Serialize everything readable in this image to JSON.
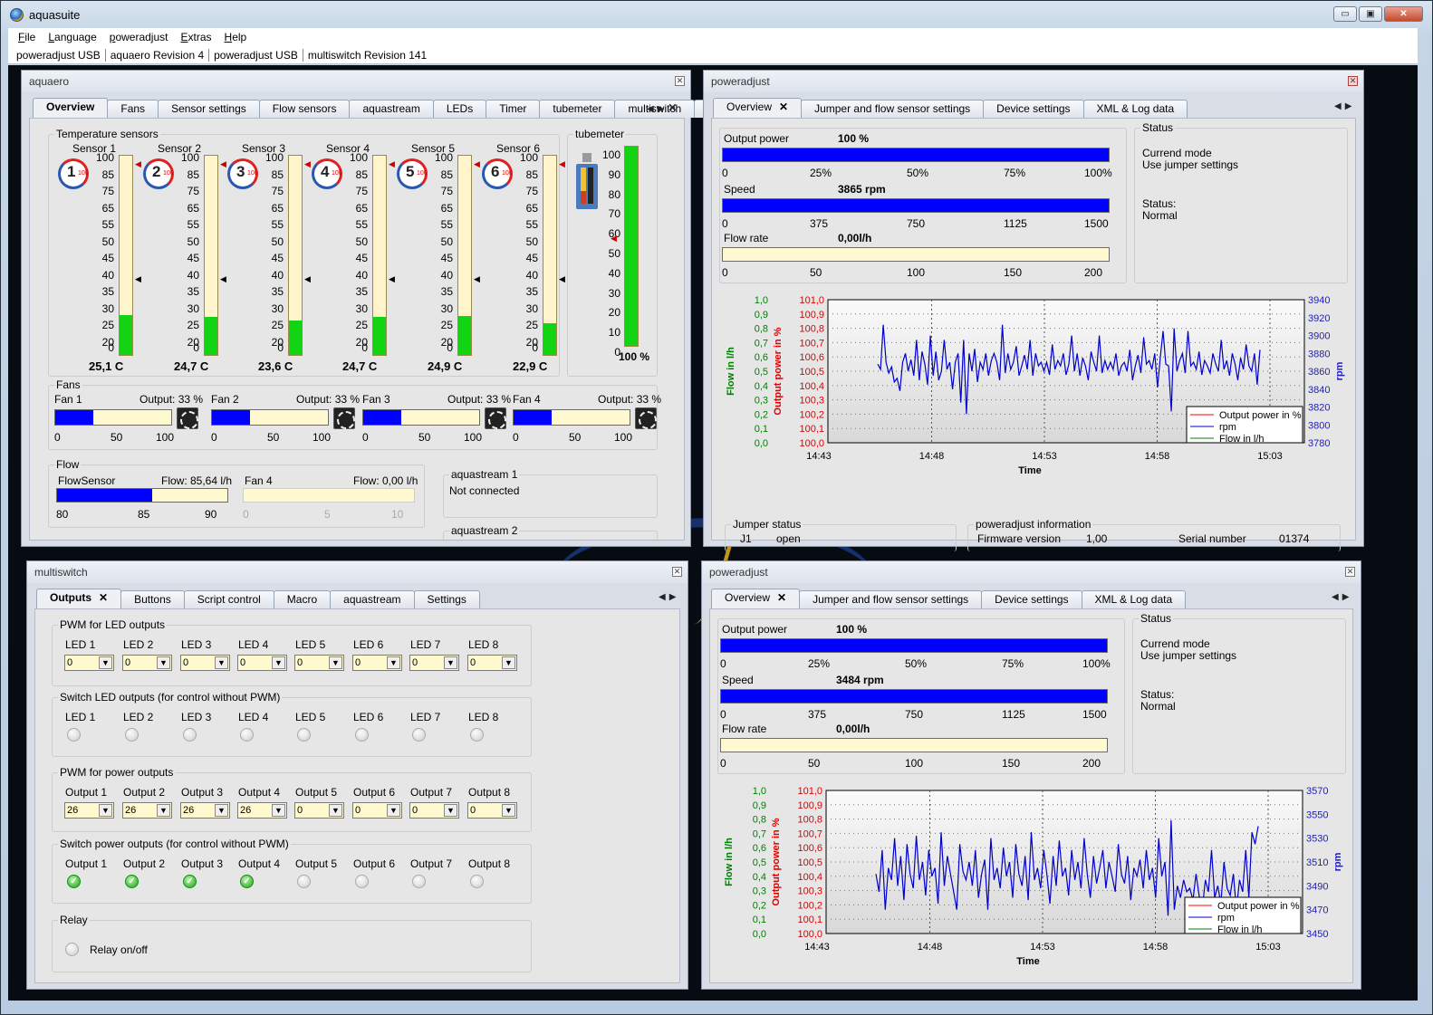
{
  "app": {
    "title": "aquasuite"
  },
  "window_buttons": {
    "minimize": "▭",
    "maximize": "▣",
    "close": "✕"
  },
  "menu": [
    {
      "u": "F",
      "rest": "ile"
    },
    {
      "u": "L",
      "rest": "anguage"
    },
    {
      "u": "p",
      "rest": "oweradjust"
    },
    {
      "u": "E",
      "rest": "xtras"
    },
    {
      "u": "H",
      "rest": "elp"
    }
  ],
  "statusbar": [
    "poweradjust USB",
    "aquaero Revision 4",
    "poweradjust USB",
    "multiswitch Revision 141"
  ],
  "aquaero": {
    "title": "aquaero",
    "tabs": [
      "Overview",
      "Fans",
      "Sensor settings",
      "Flow sensors",
      "aquastream",
      "LEDs",
      "Timer",
      "tubemeter",
      "multiswitch",
      "Po"
    ],
    "temp_group": "Temperature sensors",
    "scale": [
      "100",
      "85",
      "75",
      "65",
      "55",
      "50",
      "45",
      "40",
      "35",
      "30",
      "25",
      "20",
      "0"
    ],
    "sensors": [
      {
        "name": "Sensor 1",
        "num": "1",
        "value": "25,1 C",
        "level": 0.2
      },
      {
        "name": "Sensor 2",
        "num": "2",
        "value": "24,7 C",
        "level": 0.19
      },
      {
        "name": "Sensor 3",
        "num": "3",
        "value": "23,6 C",
        "level": 0.175
      },
      {
        "name": "Sensor 4",
        "num": "4",
        "value": "24,7 C",
        "level": 0.19
      },
      {
        "name": "Sensor 5",
        "num": "5",
        "value": "24,9 C",
        "level": 0.195
      },
      {
        "name": "Sensor 6",
        "num": "6",
        "value": "22,9 C",
        "level": 0.16
      }
    ],
    "gauge_max": "100",
    "tubemeter": {
      "title": "tubemeter",
      "scale": [
        "100",
        "90",
        "80",
        "70",
        "60",
        "50",
        "40",
        "30",
        "20",
        "10",
        "0"
      ],
      "value": "100 %",
      "level": 1.0
    },
    "fans_group": "Fans",
    "fans": [
      {
        "name": "Fan 1",
        "output": "Output: 33 %",
        "level": 0.33,
        "ticks": [
          "0",
          "50",
          "100"
        ]
      },
      {
        "name": "Fan 2",
        "output": "Output: 33 %",
        "level": 0.33,
        "ticks": [
          "0",
          "50",
          "100"
        ]
      },
      {
        "name": "Fan 3",
        "output": "Output: 33 %",
        "level": 0.33,
        "ticks": [
          "0",
          "50",
          "100"
        ]
      },
      {
        "name": "Fan 4",
        "output": "Output: 33 %",
        "level": 0.33,
        "ticks": [
          "0",
          "50",
          "100"
        ]
      }
    ],
    "flow_group": "Flow",
    "flow1": {
      "name": "FlowSensor",
      "flow": "Flow: 85,64 l/h",
      "level": 0.56,
      "ticks": [
        "80",
        "85",
        "90"
      ]
    },
    "flow2": {
      "name": "Fan 4",
      "flow": "Flow: 0,00 l/h",
      "ticks": [
        "0",
        "5",
        "10"
      ]
    },
    "aquastream1": {
      "title": "aquastream 1",
      "status": "Not connected"
    },
    "aquastream2": {
      "title": "aquastream 2"
    }
  },
  "pa1": {
    "title": "poweradjust",
    "tabs": [
      "Overview",
      "Jumper and flow sensor settings",
      "Device settings",
      "XML & Log data"
    ],
    "output_power": {
      "label": "Output power",
      "value": "100 %",
      "level": 1.0,
      "ticks": [
        "0",
        "25%",
        "50%",
        "75%",
        "100%"
      ]
    },
    "speed": {
      "label": "Speed",
      "value": "3865 rpm",
      "level": 1.0,
      "ticks": [
        "0",
        "375",
        "750",
        "1125",
        "1500"
      ]
    },
    "flow_rate": {
      "label": "Flow rate",
      "value": "0,00l/h",
      "level": 0.0,
      "ticks": [
        "0",
        "50",
        "100",
        "150",
        "200"
      ]
    },
    "status": {
      "title": "Status",
      "mode_label": "Currend mode",
      "mode": "Use jumper settings",
      "status_label": "Status:",
      "status": "Normal"
    },
    "jumper": {
      "title": "Jumper status",
      "j": "J1",
      "state": "open"
    },
    "info": {
      "title": "poweradjust information",
      "fw_label": "Firmware version",
      "fw": "1,00",
      "sn_label": "Serial number",
      "sn": "01374"
    }
  },
  "pa2": {
    "title": "poweradjust",
    "tabs": [
      "Overview",
      "Jumper and flow sensor settings",
      "Device settings",
      "XML & Log data"
    ],
    "output_power": {
      "label": "Output power",
      "value": "100 %",
      "level": 1.0,
      "ticks": [
        "0",
        "25%",
        "50%",
        "75%",
        "100%"
      ]
    },
    "speed": {
      "label": "Speed",
      "value": "3484 rpm",
      "level": 1.0,
      "ticks": [
        "0",
        "375",
        "750",
        "1125",
        "1500"
      ]
    },
    "flow_rate": {
      "label": "Flow rate",
      "value": "0,00l/h",
      "level": 0.0,
      "ticks": [
        "0",
        "50",
        "100",
        "150",
        "200"
      ]
    },
    "status": {
      "title": "Status",
      "mode_label": "Currend mode",
      "mode": "Use jumper settings",
      "status_label": "Status:",
      "status": "Normal"
    }
  },
  "chart_data": [
    {
      "type": "line",
      "x_ticks": [
        "14:43",
        "14:48",
        "14:53",
        "14:58",
        "15:03"
      ],
      "xlabel": "Time",
      "y_flow_label": "Flow in l/h",
      "y_flow_ticks": [
        "1,0",
        "0,9",
        "0,8",
        "0,7",
        "0,6",
        "0,5",
        "0,4",
        "0,3",
        "0,2",
        "0,1",
        "0,0"
      ],
      "y_power_label": "Output power in %",
      "y_power_ticks": [
        "101,0",
        "100,9",
        "100,8",
        "100,7",
        "100,6",
        "100,5",
        "100,4",
        "100,3",
        "100,2",
        "100,1",
        "100,0"
      ],
      "y_rpm_label": "rpm",
      "y_rpm_ticks": [
        "3940",
        "3920",
        "3900",
        "3880",
        "3860",
        "3840",
        "3820",
        "3800",
        "3780"
      ],
      "rpm_range": [
        3780,
        3940
      ],
      "series": [
        {
          "name": "Output power in %",
          "color": "#ff0000"
        },
        {
          "name": "rpm",
          "color": "#0000cc",
          "values": [
            3868,
            3862,
            3912,
            3870,
            3858,
            3865,
            3848,
            3852,
            3838,
            3870,
            3880,
            3860,
            3873,
            3855,
            3895,
            3850,
            3882,
            3868,
            3845,
            3900,
            3855,
            3882,
            3850,
            3860,
            3895,
            3862,
            3870,
            3840,
            3870,
            3880,
            3825,
            3895,
            3812,
            3880,
            3860,
            3885,
            3848,
            3870,
            3862,
            3880,
            3855,
            3872,
            3880,
            3870,
            3850,
            3912,
            3858,
            3880,
            3862,
            3870,
            3888,
            3855,
            3866,
            3878,
            3862,
            3895,
            3855,
            3880,
            3866,
            3870,
            3860,
            3870,
            3856,
            3890,
            3862,
            3872,
            3866,
            3880,
            3856,
            3868,
            3900,
            3860,
            3880,
            3855,
            3875,
            3866,
            3850,
            3882,
            3870,
            3860,
            3900,
            3858,
            3872,
            3862,
            3870,
            3862,
            3880,
            3855,
            3866,
            3870,
            3860,
            3884,
            3850,
            3866,
            3878,
            3858,
            3898,
            3868,
            3872,
            3862,
            3880,
            3842,
            3875,
            3905,
            3868,
            3866,
            3815,
            3908,
            3860,
            3872,
            3880,
            3858,
            3905,
            3866,
            3870,
            3862,
            3882,
            3856,
            3872,
            3866,
            3858,
            3880,
            3868,
            3860,
            3895,
            3862,
            3872,
            3855,
            3880,
            3868,
            3850,
            3875,
            3862,
            3890,
            3866,
            3860,
            3880,
            3845,
            3884
          ]
        },
        {
          "name": "Flow in l/h",
          "color": "#008000"
        }
      ]
    },
    {
      "type": "line",
      "x_ticks": [
        "14:43",
        "14:48",
        "14:53",
        "14:58",
        "15:03"
      ],
      "xlabel": "Time",
      "y_flow_label": "Flow in l/h",
      "y_flow_ticks": [
        "1,0",
        "0,9",
        "0,8",
        "0,7",
        "0,6",
        "0,5",
        "0,4",
        "0,3",
        "0,2",
        "0,1",
        "0,0"
      ],
      "y_power_label": "Output power in %",
      "y_power_ticks": [
        "101,0",
        "100,9",
        "100,8",
        "100,7",
        "100,6",
        "100,5",
        "100,4",
        "100,3",
        "100,2",
        "100,1",
        "100,0"
      ],
      "y_rpm_label": "rpm",
      "y_rpm_ticks": [
        "3570",
        "3550",
        "3530",
        "3510",
        "3490",
        "3470",
        "3450"
      ],
      "rpm_range": [
        3450,
        3570
      ],
      "series": [
        {
          "name": "Output power in %",
          "color": "#ff0000"
        },
        {
          "name": "rpm",
          "color": "#0000cc",
          "values": [
            3500,
            3485,
            3520,
            3470,
            3505,
            3495,
            3530,
            3490,
            3515,
            3478,
            3525,
            3500,
            3488,
            3532,
            3495,
            3510,
            3482,
            3520,
            3498,
            3505,
            3475,
            3535,
            3490,
            3515,
            3500,
            3485,
            3470,
            3525,
            3502,
            3495,
            3510,
            3490,
            3520,
            3480,
            3500,
            3512,
            3470,
            3530,
            3495,
            3505,
            3488,
            3522,
            3498,
            3510,
            3480,
            3525,
            3500,
            3490,
            3515,
            3478,
            3535,
            3495,
            3505,
            3488,
            3520,
            3500,
            3475,
            3515,
            3490,
            3528,
            3498,
            3505,
            3482,
            3520,
            3495,
            3510,
            3488,
            3530,
            3500,
            3480,
            3515,
            3492,
            3505,
            3520,
            3488,
            3510,
            3498,
            3485,
            3525,
            3500,
            3492,
            3515,
            3478,
            3505,
            3498,
            3512,
            3488,
            3520,
            3495,
            3505,
            3480,
            3530,
            3498,
            3510,
            3465,
            3545,
            3470,
            3490,
            3480,
            3495,
            3485,
            3488,
            3478,
            3500,
            3482,
            3470,
            3495,
            3485,
            3520,
            3480,
            3490,
            3475,
            3510,
            3488,
            3482,
            3500,
            3470,
            3495,
            3485,
            3520,
            3480,
            3535,
            3525,
            3540
          ]
        },
        {
          "name": "Flow in l/h",
          "color": "#008000"
        }
      ]
    }
  ],
  "multiswitch": {
    "title": "multiswitch",
    "tabs": [
      "Outputs",
      "Buttons",
      "Script control",
      "Macro",
      "aquastream",
      "Settings"
    ],
    "pwm_led_group": "PWM for LED outputs",
    "led_labels": [
      "LED 1",
      "LED 2",
      "LED 3",
      "LED 4",
      "LED 5",
      "LED 6",
      "LED 7",
      "LED 8"
    ],
    "led_pwm_values": [
      "0",
      "0",
      "0",
      "0",
      "0",
      "0",
      "0",
      "0"
    ],
    "switch_led_group": "Switch LED outputs (for control without PWM)",
    "pwm_power_group": "PWM for power outputs",
    "output_labels": [
      "Output 1",
      "Output 2",
      "Output 3",
      "Output 4",
      "Output 5",
      "Output 6",
      "Output 7",
      "Output 8"
    ],
    "output_pwm_values": [
      "26",
      "26",
      "26",
      "26",
      "0",
      "0",
      "0",
      "0"
    ],
    "switch_power_group": "Switch power outputs (for control without PWM)",
    "power_switch_states": [
      true,
      true,
      true,
      true,
      false,
      false,
      false,
      false
    ],
    "relay_group": "Relay",
    "relay_label": "Relay on/off",
    "relay_state": false
  }
}
